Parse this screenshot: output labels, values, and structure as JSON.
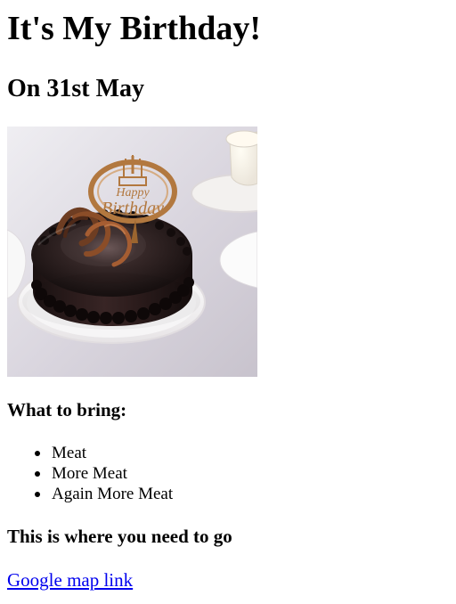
{
  "heading": "It's My Birthday!",
  "subheading": "On 31st May",
  "image": {
    "alt": "Chocolate birthday cake with Happy Birthday topper",
    "topper_line1": "Happy",
    "topper_line2": "Birthday",
    "colors": {
      "background": "#dedbe3",
      "cake": "#2a1c1c",
      "topper": "#b2783f",
      "plate": "#f4f3f3"
    }
  },
  "bring": {
    "title": "What to bring:",
    "items": [
      "Meat",
      "More Meat",
      "Again More Meat"
    ]
  },
  "directions": {
    "title": "This is where you need to go",
    "link_label": "Google map link"
  },
  "colors": {
    "text": "#000000",
    "link": "#0000ee"
  }
}
